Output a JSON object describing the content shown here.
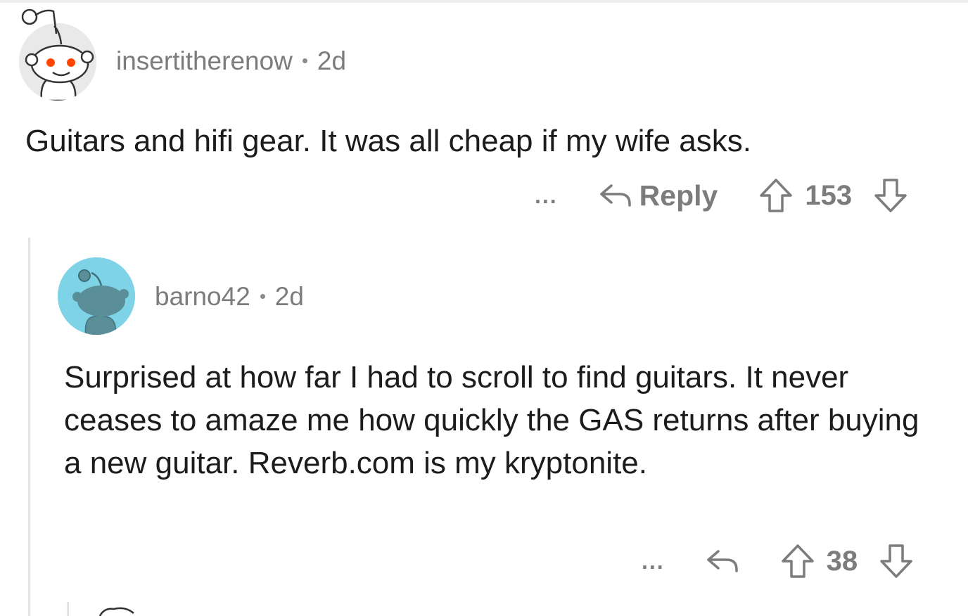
{
  "comments": [
    {
      "username": "insertitherenow",
      "age": "2d",
      "text": "Guitars and hifi gear. It was all cheap if my wife asks.",
      "more_label": "...",
      "reply_label": "Reply",
      "score": "153"
    },
    {
      "username": "barno42",
      "age": "2d",
      "text": "Surprised at how far I had to scroll to find guitars. It never ceases to amaze me how quickly the GAS returns after buying a new guitar. Reverb.com is my kryptonite.",
      "more_label": "...",
      "score": "38"
    }
  ],
  "colors": {
    "avatar1_bg": "#e9e9e9",
    "avatar2_bg": "#7ed3e6",
    "meta_text": "#7c7c7c",
    "body_text": "#1c1c1c",
    "snoo_eye": "#ff4500",
    "thread_line": "#e4e4e4"
  }
}
